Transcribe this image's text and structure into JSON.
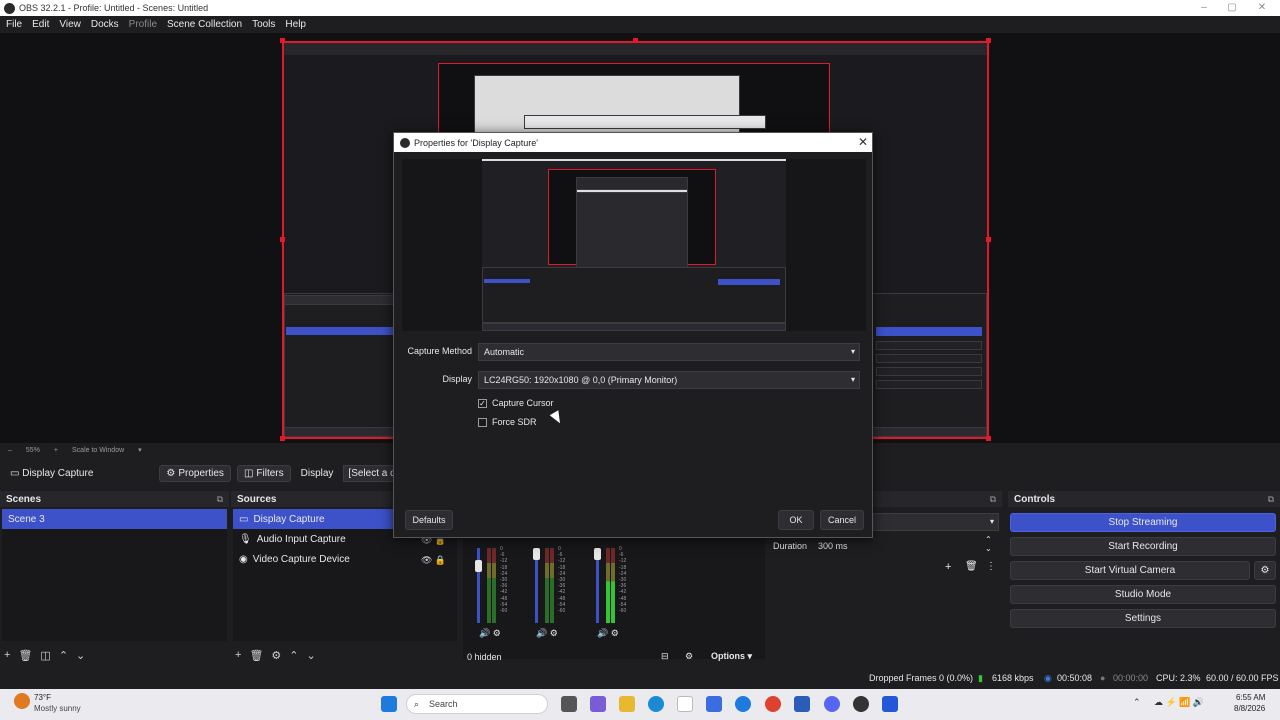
{
  "window": {
    "title": "OBS 32.2.1 - Profile: Untitled - Scenes: Untitled"
  },
  "menu": [
    "File",
    "Edit",
    "View",
    "Docks",
    "Profile",
    "Scene Collection",
    "Tools",
    "Help"
  ],
  "preview_bar": {
    "zoom": "55%",
    "scale_mode": "Scale to Window"
  },
  "source_toolbar": {
    "selected_source": "Display Capture",
    "properties": "Properties",
    "filters": "Filters",
    "display_label": "Display",
    "display_value": "[Select a display to"
  },
  "scenes": {
    "title": "Scenes",
    "items": [
      "Scene 3"
    ]
  },
  "sources": {
    "title": "Sources",
    "items": [
      "Display Capture",
      "Audio Input Capture",
      "Video Capture Device"
    ]
  },
  "mixer": {
    "hidden_label": "0 hidden",
    "options": "Options",
    "db_ticks": [
      "0",
      "-6",
      "-12",
      "-18",
      "-24",
      "-30",
      "-36",
      "-42",
      "-48",
      "-54",
      "-60"
    ]
  },
  "transitions": {
    "duration_label": "Duration",
    "duration_value": "300 ms"
  },
  "controls": {
    "title": "Controls",
    "buttons": [
      "Stop Streaming",
      "Start Recording",
      "Start Virtual Camera",
      "Studio Mode",
      "Settings"
    ]
  },
  "status_bar": {
    "dropped_frames": "Dropped Frames 0 (0.0%)",
    "bitrate": "6168 kbps",
    "stream_time": "00:50:08",
    "rec_time": "00:00:00",
    "cpu": "CPU: 2.3%",
    "fps": "60.00 / 60.00 FPS"
  },
  "dialog": {
    "title": "Properties for 'Display Capture'",
    "capture_method_label": "Capture Method",
    "capture_method_value": "Automatic",
    "display_label": "Display",
    "display_value": "LC24RG50: 1920x1080 @ 0,0 (Primary Monitor)",
    "capture_cursor_label": "Capture Cursor",
    "capture_cursor_checked": true,
    "force_sdr_label": "Force SDR",
    "force_sdr_checked": false,
    "defaults_button": "Defaults",
    "ok_button": "OK",
    "cancel_button": "Cancel"
  },
  "taskbar": {
    "weather_temp": "73°F",
    "weather_desc": "Mostly sunny",
    "search_placeholder": "Search",
    "time": "6:55 AM",
    "date": "8/8/2026"
  },
  "colors": {
    "accent": "#3d52c9",
    "selection_red": "#e01a2a",
    "bg": "#1e1e21"
  }
}
